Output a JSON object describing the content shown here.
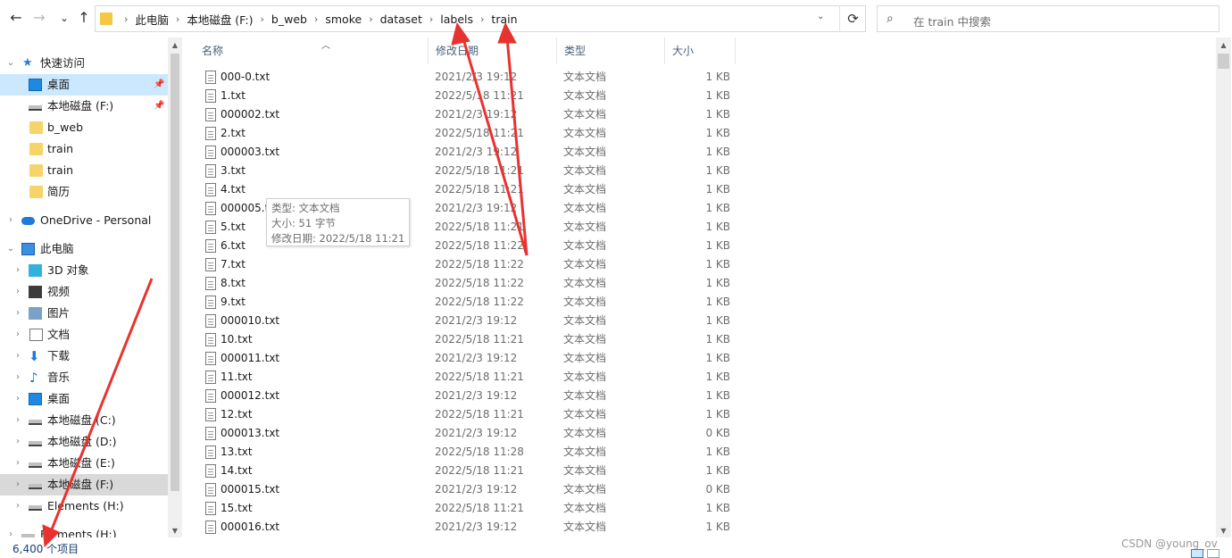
{
  "nav": {
    "back_icon": "←",
    "forward_icon": "→",
    "recent_icon": "⌄",
    "up_icon": "↑",
    "refresh_icon": "⟳",
    "dropdown_icon": "⌄"
  },
  "address": {
    "crumbs": [
      "此电脑",
      "本地磁盘 (F:)",
      "b_web",
      "smoke",
      "dataset",
      "labels",
      "train"
    ]
  },
  "search": {
    "placeholder": "在 train 中搜索",
    "icon": "⌕"
  },
  "sidebar": {
    "items": [
      {
        "label": "快速访问",
        "icon": "star-icon"
      },
      {
        "label": "桌面",
        "icon": "desktop-icon"
      },
      {
        "label": "本地磁盘 (F:)",
        "icon": "drive-icon"
      },
      {
        "label": "b_web",
        "icon": "folder-icon"
      },
      {
        "label": "train",
        "icon": "folder-icon"
      },
      {
        "label": "train",
        "icon": "folder-icon"
      },
      {
        "label": "简历",
        "icon": "folder-icon"
      },
      {
        "label": "OneDrive - Personal",
        "icon": "cloud-icon"
      },
      {
        "label": "此电脑",
        "icon": "pc-icon"
      },
      {
        "label": "3D 对象",
        "icon": "cube-icon"
      },
      {
        "label": "视频",
        "icon": "video-icon"
      },
      {
        "label": "图片",
        "icon": "picture-icon"
      },
      {
        "label": "文档",
        "icon": "document-icon"
      },
      {
        "label": "下载",
        "icon": "download-icon"
      },
      {
        "label": "音乐",
        "icon": "music-icon"
      },
      {
        "label": "桌面",
        "icon": "desktop-icon"
      },
      {
        "label": "本地磁盘 (C:)",
        "icon": "drive-icon"
      },
      {
        "label": "本地磁盘 (D:)",
        "icon": "drive-icon"
      },
      {
        "label": "本地磁盘 (E:)",
        "icon": "drive-icon"
      },
      {
        "label": "本地磁盘 (F:)",
        "icon": "drive-icon"
      },
      {
        "label": "Elements (H:)",
        "icon": "drive-icon"
      },
      {
        "label": "Elements (H:)",
        "icon": "drive-icon"
      }
    ]
  },
  "columns": {
    "name": "名称",
    "date": "修改日期",
    "type": "类型",
    "size": "大小"
  },
  "files": [
    {
      "name": "000-0.txt",
      "date": "2021/2/3 19:12",
      "type": "文本文档",
      "size": "1 KB"
    },
    {
      "name": "1.txt",
      "date": "2022/5/18 11:21",
      "type": "文本文档",
      "size": "1 KB"
    },
    {
      "name": "000002.txt",
      "date": "2021/2/3 19:12",
      "type": "文本文档",
      "size": "1 KB"
    },
    {
      "name": "2.txt",
      "date": "2022/5/18 11:21",
      "type": "文本文档",
      "size": "1 KB"
    },
    {
      "name": "000003.txt",
      "date": "2021/2/3 19:12",
      "type": "文本文档",
      "size": "1 KB"
    },
    {
      "name": "3.txt",
      "date": "2022/5/18 11:21",
      "type": "文本文档",
      "size": "1 KB"
    },
    {
      "name": "4.txt",
      "date": "2022/5/18 11:21",
      "type": "文本文档",
      "size": "1 KB"
    },
    {
      "name": "000005.txt",
      "date": "2021/2/3 19:12",
      "type": "文本文档",
      "size": "1 KB"
    },
    {
      "name": "5.txt",
      "date": "2022/5/18 11:21",
      "type": "文本文档",
      "size": "1 KB"
    },
    {
      "name": "6.txt",
      "date": "2022/5/18 11:22",
      "type": "文本文档",
      "size": "1 KB"
    },
    {
      "name": "7.txt",
      "date": "2022/5/18 11:22",
      "type": "文本文档",
      "size": "1 KB"
    },
    {
      "name": "8.txt",
      "date": "2022/5/18 11:22",
      "type": "文本文档",
      "size": "1 KB"
    },
    {
      "name": "9.txt",
      "date": "2022/5/18 11:22",
      "type": "文本文档",
      "size": "1 KB"
    },
    {
      "name": "000010.txt",
      "date": "2021/2/3 19:12",
      "type": "文本文档",
      "size": "1 KB"
    },
    {
      "name": "10.txt",
      "date": "2022/5/18 11:21",
      "type": "文本文档",
      "size": "1 KB"
    },
    {
      "name": "000011.txt",
      "date": "2021/2/3 19:12",
      "type": "文本文档",
      "size": "1 KB"
    },
    {
      "name": "11.txt",
      "date": "2022/5/18 11:21",
      "type": "文本文档",
      "size": "1 KB"
    },
    {
      "name": "000012.txt",
      "date": "2021/2/3 19:12",
      "type": "文本文档",
      "size": "1 KB"
    },
    {
      "name": "12.txt",
      "date": "2022/5/18 11:21",
      "type": "文本文档",
      "size": "1 KB"
    },
    {
      "name": "000013.txt",
      "date": "2021/2/3 19:12",
      "type": "文本文档",
      "size": "0 KB"
    },
    {
      "name": "13.txt",
      "date": "2022/5/18 11:28",
      "type": "文本文档",
      "size": "1 KB"
    },
    {
      "name": "14.txt",
      "date": "2022/5/18 11:21",
      "type": "文本文档",
      "size": "1 KB"
    },
    {
      "name": "000015.txt",
      "date": "2021/2/3 19:12",
      "type": "文本文档",
      "size": "0 KB"
    },
    {
      "name": "15.txt",
      "date": "2022/5/18 11:21",
      "type": "文本文档",
      "size": "1 KB"
    },
    {
      "name": "000016.txt",
      "date": "2021/2/3 19:12",
      "type": "文本文档",
      "size": "1 KB"
    }
  ],
  "tooltip": {
    "type_line": "类型: 文本文档",
    "size_line": "大小: 51 字节",
    "date_line": "修改日期: 2022/5/18 11:21"
  },
  "status": {
    "count": "6,400 个项目"
  },
  "watermark": "CSDN @young_ov",
  "colors": {
    "accent": "#1e7ad6",
    "selected_bg": "#cce8ff",
    "annotation_red": "#e8322f"
  }
}
